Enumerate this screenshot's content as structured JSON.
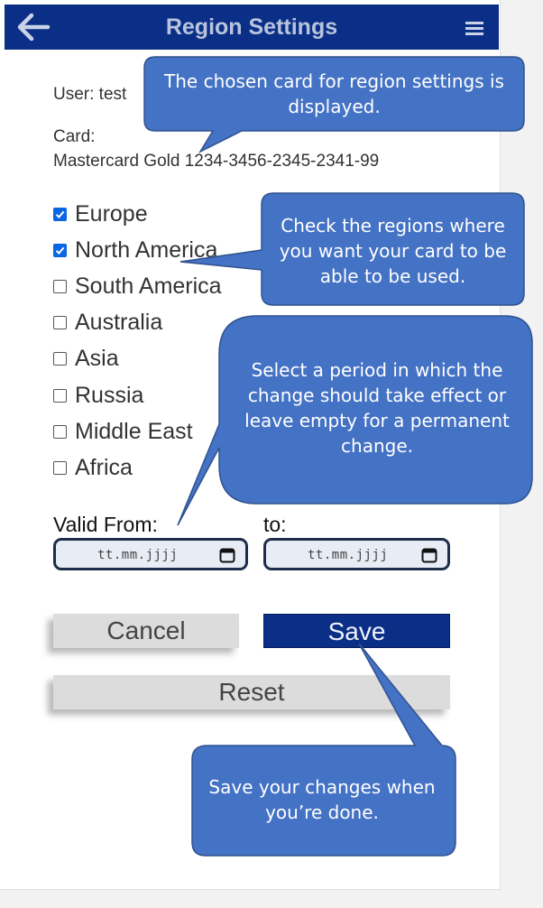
{
  "header": {
    "title": "Region Settings",
    "back_icon": "arrow-left-icon",
    "menu_icon": "hamburger-menu-icon",
    "background": "#0b2f87"
  },
  "user_line": "User: test",
  "card": {
    "label": "Card:",
    "value": "Mastercard Gold 1234-3456-2345-2341-99"
  },
  "regions": [
    {
      "label": "Europe",
      "checked": true
    },
    {
      "label": "North America",
      "checked": true
    },
    {
      "label": "South America",
      "checked": false
    },
    {
      "label": "Australia",
      "checked": false
    },
    {
      "label": "Asia",
      "checked": false
    },
    {
      "label": "Russia",
      "checked": false
    },
    {
      "label": "Middle East",
      "checked": false
    },
    {
      "label": "Africa",
      "checked": false
    }
  ],
  "validity": {
    "from_label": "Valid From:",
    "to_label": "to:",
    "from_placeholder": "tt.mm.jjjj",
    "to_placeholder": "tt.mm.jjjj"
  },
  "buttons": {
    "cancel": "Cancel",
    "save": "Save",
    "reset": "Reset"
  },
  "callouts": {
    "card": "The chosen card for region settings is displayed.",
    "regions": "Check the regions where you want your card to be able to be used.",
    "period": "Select a period in which the change should take effect or leave empty for a permanent change.",
    "save": "Save your changes when you’re done."
  },
  "colors": {
    "header": "#0b2f87",
    "save_button": "#0b2f87",
    "callout_fill": "#4472c4",
    "callout_border": "#2f528f",
    "checkbox_checked": "#0b66e3"
  }
}
